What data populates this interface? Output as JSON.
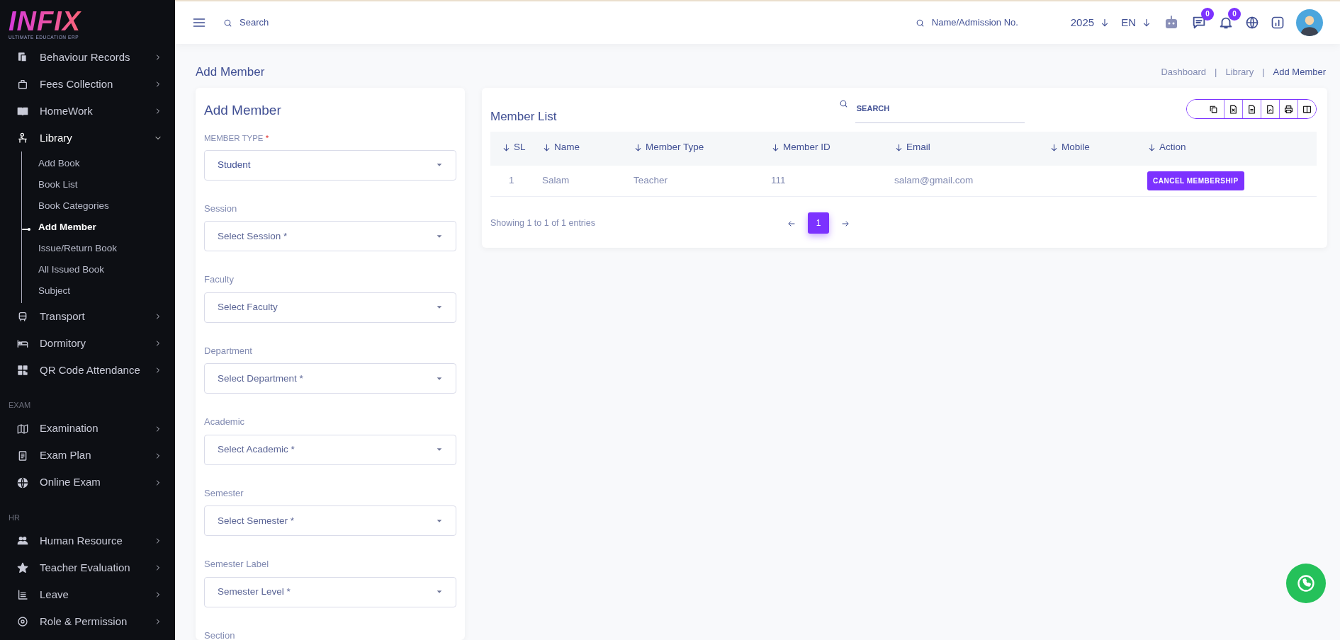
{
  "sidebar": {
    "logo": {
      "title": "INFIX",
      "subtitle": "ULTIMATE EDUCATION ERP"
    },
    "sections": [
      {
        "items": [
          {
            "label": "Behaviour Records",
            "expanded": false
          },
          {
            "label": "Fees Collection",
            "expanded": false
          },
          {
            "label": "HomeWork",
            "expanded": false
          },
          {
            "label": "Library",
            "expanded": true,
            "children": [
              {
                "label": "Add Book",
                "selected": false
              },
              {
                "label": "Book List",
                "selected": false
              },
              {
                "label": "Book Categories",
                "selected": false
              },
              {
                "label": "Add Member",
                "selected": true
              },
              {
                "label": "Issue/Return Book",
                "selected": false
              },
              {
                "label": "All Issued Book",
                "selected": false
              },
              {
                "label": "Subject",
                "selected": false
              }
            ]
          },
          {
            "label": "Transport",
            "expanded": false
          },
          {
            "label": "Dormitory",
            "expanded": false
          },
          {
            "label": "QR Code Attendance",
            "expanded": false
          }
        ]
      },
      {
        "heading": "EXAM",
        "items": [
          {
            "label": "Examination",
            "expanded": false
          },
          {
            "label": "Exam Plan",
            "expanded": false
          },
          {
            "label": "Online Exam",
            "expanded": false
          }
        ]
      },
      {
        "heading": "HR",
        "items": [
          {
            "label": "Human Resource",
            "expanded": false
          },
          {
            "label": "Teacher Evaluation",
            "expanded": false
          },
          {
            "label": "Leave",
            "expanded": false
          },
          {
            "label": "Role & Permission",
            "expanded": false
          }
        ]
      }
    ]
  },
  "header": {
    "search": {
      "placeholder": "Search"
    },
    "student_search": {
      "placeholder": "Name/Admission No."
    },
    "year": "2025",
    "language": "EN",
    "messages_count": "0",
    "notifications_count": "0"
  },
  "page": {
    "title": "Add Member",
    "breadcrumb_separator": "|",
    "breadcrumb": [
      {
        "label": "Dashboard",
        "selected": false
      },
      {
        "label": "Library",
        "selected": false
      },
      {
        "label": "Add Member",
        "selected": true
      }
    ]
  },
  "form": {
    "title": "Add Member",
    "fields": [
      {
        "kind": "select",
        "label": "MEMBER TYPE",
        "required_mark": "*",
        "value": "Student"
      },
      {
        "kind": "select",
        "label": "Session",
        "placeholder": "Select Session *"
      },
      {
        "kind": "select",
        "label": "Faculty",
        "placeholder": "Select Faculty"
      },
      {
        "kind": "select",
        "label": "Department",
        "placeholder": "Select Department *"
      },
      {
        "kind": "select",
        "label": "Academic",
        "placeholder": "Select Academic *"
      },
      {
        "kind": "select",
        "label": "Semester",
        "placeholder": "Select Semester *"
      },
      {
        "kind": "select",
        "label": "Semester Label",
        "placeholder": "Semester Level *"
      },
      {
        "kind": "label",
        "label": "Section"
      }
    ]
  },
  "member_list": {
    "title": "Member List",
    "search": {
      "placeholder": "SEARCH"
    },
    "table": {
      "columns": [
        "SL",
        "Name",
        "Member Type",
        "Member ID",
        "Email",
        "Mobile",
        "Action"
      ],
      "rows": [
        {
          "sl": "1",
          "name": "Salam",
          "member_type": "Teacher",
          "member_id": "111",
          "email": "salam@gmail.com",
          "action": "CANCEL MEMBERSHIP"
        }
      ]
    },
    "summary": "Showing 1 to 1 of 1 entries",
    "pages": [
      {
        "label": "1",
        "selected": true
      }
    ]
  }
}
